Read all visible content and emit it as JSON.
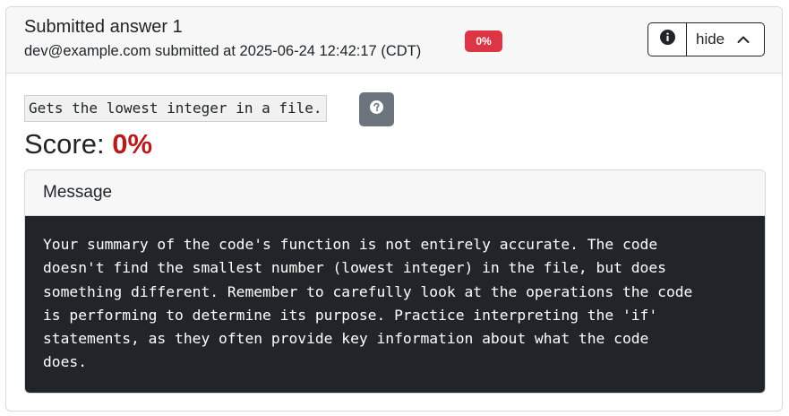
{
  "header": {
    "title": "Submitted answer 1",
    "submitted_line": "dev@example.com submitted at 2025-06-24 12:42:17 (CDT)",
    "badge": "0%",
    "badge_color": "#dc3545",
    "info_icon": "info-circle-icon",
    "hide_label": "hide",
    "chevron_icon": "chevron-up-icon"
  },
  "answer": {
    "text": "Gets the lowest integer in a file.",
    "help_icon": "question-circle-icon"
  },
  "score": {
    "label": "Score:",
    "value": "0%",
    "value_color": "#b71c1c"
  },
  "message": {
    "title": "Message",
    "body": "Your summary of the code's function is not entirely accurate. The code\ndoesn't find the smallest number (lowest integer) in the file, but does\nsomething different. Remember to carefully look at the operations the code\nis performing to determine its purpose. Practice interpreting the 'if'\nstatements, as they often provide key information about what the code\ndoes."
  }
}
